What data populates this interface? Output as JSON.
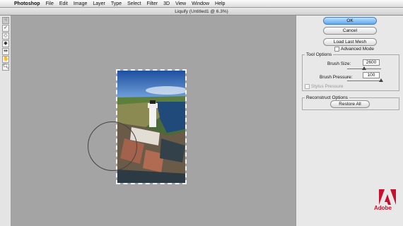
{
  "menu": {
    "apple": "",
    "app": "Photoshop",
    "items": [
      "File",
      "Edit",
      "Image",
      "Layer",
      "Type",
      "Select",
      "Filter",
      "3D",
      "View",
      "Window",
      "Help"
    ]
  },
  "window": {
    "title": "Liquify (Untitled1 @ 6.3%)"
  },
  "tools": [
    "forward-warp",
    "reconstruct",
    "pucker",
    "bloat",
    "push-left",
    "hand",
    "zoom"
  ],
  "panel": {
    "ok_label": "OK",
    "cancel_label": "Cancel",
    "load_mesh_label": "Load Last Mesh",
    "advanced_mode_label": "Advanced Mode",
    "tool_options": {
      "title": "Tool Options",
      "brush_size_label": "Brush Size:",
      "brush_size_value": "2600",
      "brush_size_level": 0.5,
      "brush_pressure_label": "Brush Pressure:",
      "brush_pressure_value": "100",
      "brush_pressure_level": 1.0,
      "stylus_pressure_label": "Stylus Pressure"
    },
    "reconstruct_options": {
      "title": "Reconstruct Options",
      "restore_all_label": "Restore All"
    }
  },
  "branding": {
    "logo_text": "Adobe",
    "color": "#c8102e"
  },
  "colors": {
    "ok_button": "#5fa8ee",
    "canvas_bg": "#a4a4a4",
    "panel_bg": "#e8e8e8"
  }
}
